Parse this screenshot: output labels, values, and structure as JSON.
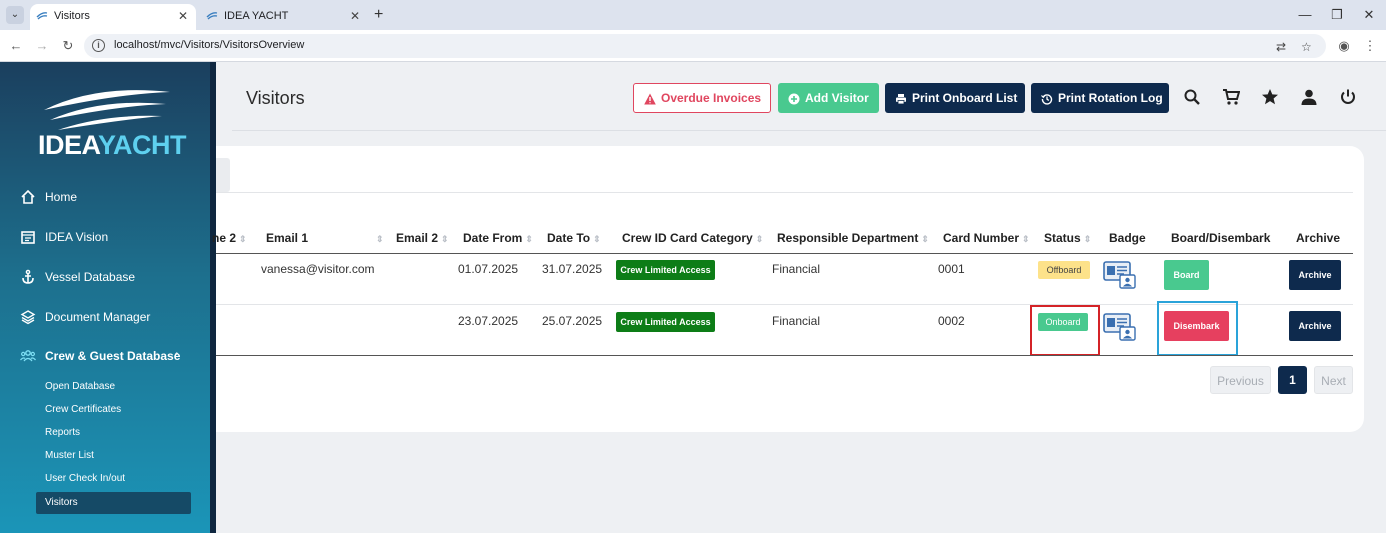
{
  "browser": {
    "tabs": [
      {
        "title": "Visitors",
        "active": true
      },
      {
        "title": "IDEA YACHT",
        "active": false
      }
    ],
    "url": "localhost/mvc/Visitors/VisitorsOverview"
  },
  "sidebar": {
    "logo_text_a": "IDEA",
    "logo_text_b": "YACHT",
    "items": [
      {
        "label": "Home",
        "icon": "home-icon"
      },
      {
        "label": "IDEA Vision",
        "icon": "calendar-icon"
      },
      {
        "label": "Vessel Database",
        "icon": "anchor-icon"
      },
      {
        "label": "Document Manager",
        "icon": "layers-icon"
      },
      {
        "label": "Crew & Guest Database",
        "icon": "users-icon",
        "expanded": true
      }
    ],
    "subitems": [
      {
        "label": "Open Database"
      },
      {
        "label": "Crew Certificates"
      },
      {
        "label": "Reports"
      },
      {
        "label": "Muster List"
      },
      {
        "label": "User Check In/out"
      },
      {
        "label": "Visitors",
        "active": true
      }
    ]
  },
  "header": {
    "title": "Visitors",
    "buttons": {
      "overdue": "Overdue Invoices",
      "add": "Add Visitor",
      "print_onboard": "Print Onboard List",
      "print_rotation": "Print Rotation Log"
    },
    "icons": [
      "search-icon",
      "cart-icon",
      "star-icon",
      "user-icon",
      "power-icon"
    ]
  },
  "table": {
    "columns": [
      "ne 2",
      "Email 1",
      "Email 2",
      "Date From",
      "Date To",
      "Crew ID Card Category",
      "Responsible Department",
      "Card Number",
      "Status",
      "Badge",
      "Board/Disembark",
      "Archive"
    ],
    "rows": [
      {
        "email1": "vanessa@visitor.com",
        "email2": "",
        "date_from": "01.07.2025",
        "date_to": "31.07.2025",
        "category": "Crew Limited Access",
        "department": "Financial",
        "card_number": "0001",
        "status": "Offboard",
        "action": "Board",
        "archive": "Archive"
      },
      {
        "email1": "",
        "email2": "",
        "date_from": "23.07.2025",
        "date_to": "25.07.2025",
        "category": "Crew Limited Access",
        "department": "Financial",
        "card_number": "0002",
        "status": "Onboard",
        "action": "Disembark",
        "archive": "Archive"
      }
    ]
  },
  "pagination": {
    "previous": "Previous",
    "current": "1",
    "next": "Next"
  },
  "colors": {
    "accent_green": "#49c98f",
    "navy": "#0e2a4d",
    "danger": "#e0465f",
    "offboard_badge": "#fde28a",
    "category_badge": "#0d7d17"
  }
}
